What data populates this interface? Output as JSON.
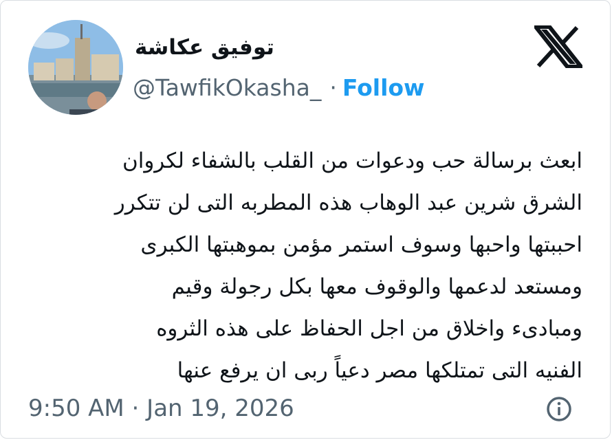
{
  "author": {
    "name": "توفيق عكاشة",
    "handle": "@TawfikOkasha_",
    "separator": "·",
    "follow_label": "Follow"
  },
  "icons": {
    "brand": "x-logo-icon",
    "info": "info-icon"
  },
  "tweet": {
    "lines": [
      "ابعث برسالة حب ودعوات من القلب بالشفاء لكروان",
      "الشرق شرين عبد الوهاب هذه المطربه التى لن تتكرر",
      "احببتها واحبها وسوف استمر مؤمن بموهبتها الكبرى",
      "ومستعد لدعمها والوقوف معها بكل رجولة وقيم",
      "ومبادىء واخلاق من اجل الحفاظ على هذه الثروه",
      "الفنيه التى تمتلكها مصر دعياً ربى ان يرفع عنها"
    ]
  },
  "meta": {
    "timestamp": "9:50 AM · Jan 19, 2026"
  },
  "colors": {
    "text": "#0f1419",
    "secondary": "#536471",
    "accent": "#1d9bf0",
    "border": "#d9dde1"
  }
}
